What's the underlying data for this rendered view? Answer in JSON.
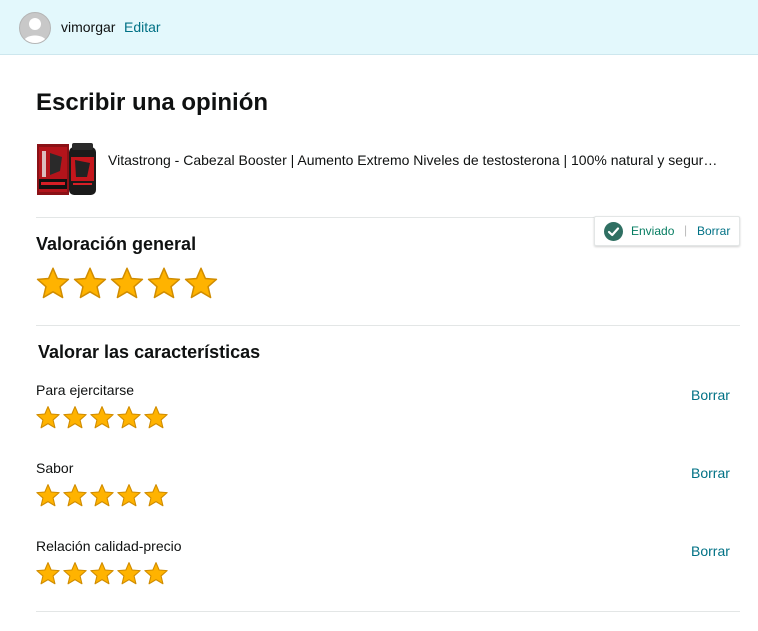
{
  "header": {
    "username": "vimorgar",
    "edit_label": "Editar"
  },
  "page": {
    "title": "Escribir una opinión"
  },
  "product": {
    "name": "Vitastrong - Cabezal Booster | Aumento Extremo Niveles de testosterona | 100% natural y segur…"
  },
  "overall": {
    "title": "Valoración general",
    "rating": 5,
    "max_rating": 5,
    "status_label": "Enviado",
    "status_separator": "|",
    "clear_label": "Borrar",
    "status_color": "#067d62"
  },
  "features": {
    "title": "Valorar las características",
    "items": [
      {
        "label": "Para ejercitarse",
        "rating": 5,
        "clear_label": "Borrar"
      },
      {
        "label": "Sabor",
        "rating": 5,
        "clear_label": "Borrar"
      },
      {
        "label": "Relación calidad-precio",
        "rating": 5,
        "clear_label": "Borrar"
      }
    ]
  },
  "colors": {
    "header_bg": "#e3f8fc",
    "link": "#007185",
    "star_fill": "#ffb300",
    "star_stroke": "#d08c00"
  }
}
